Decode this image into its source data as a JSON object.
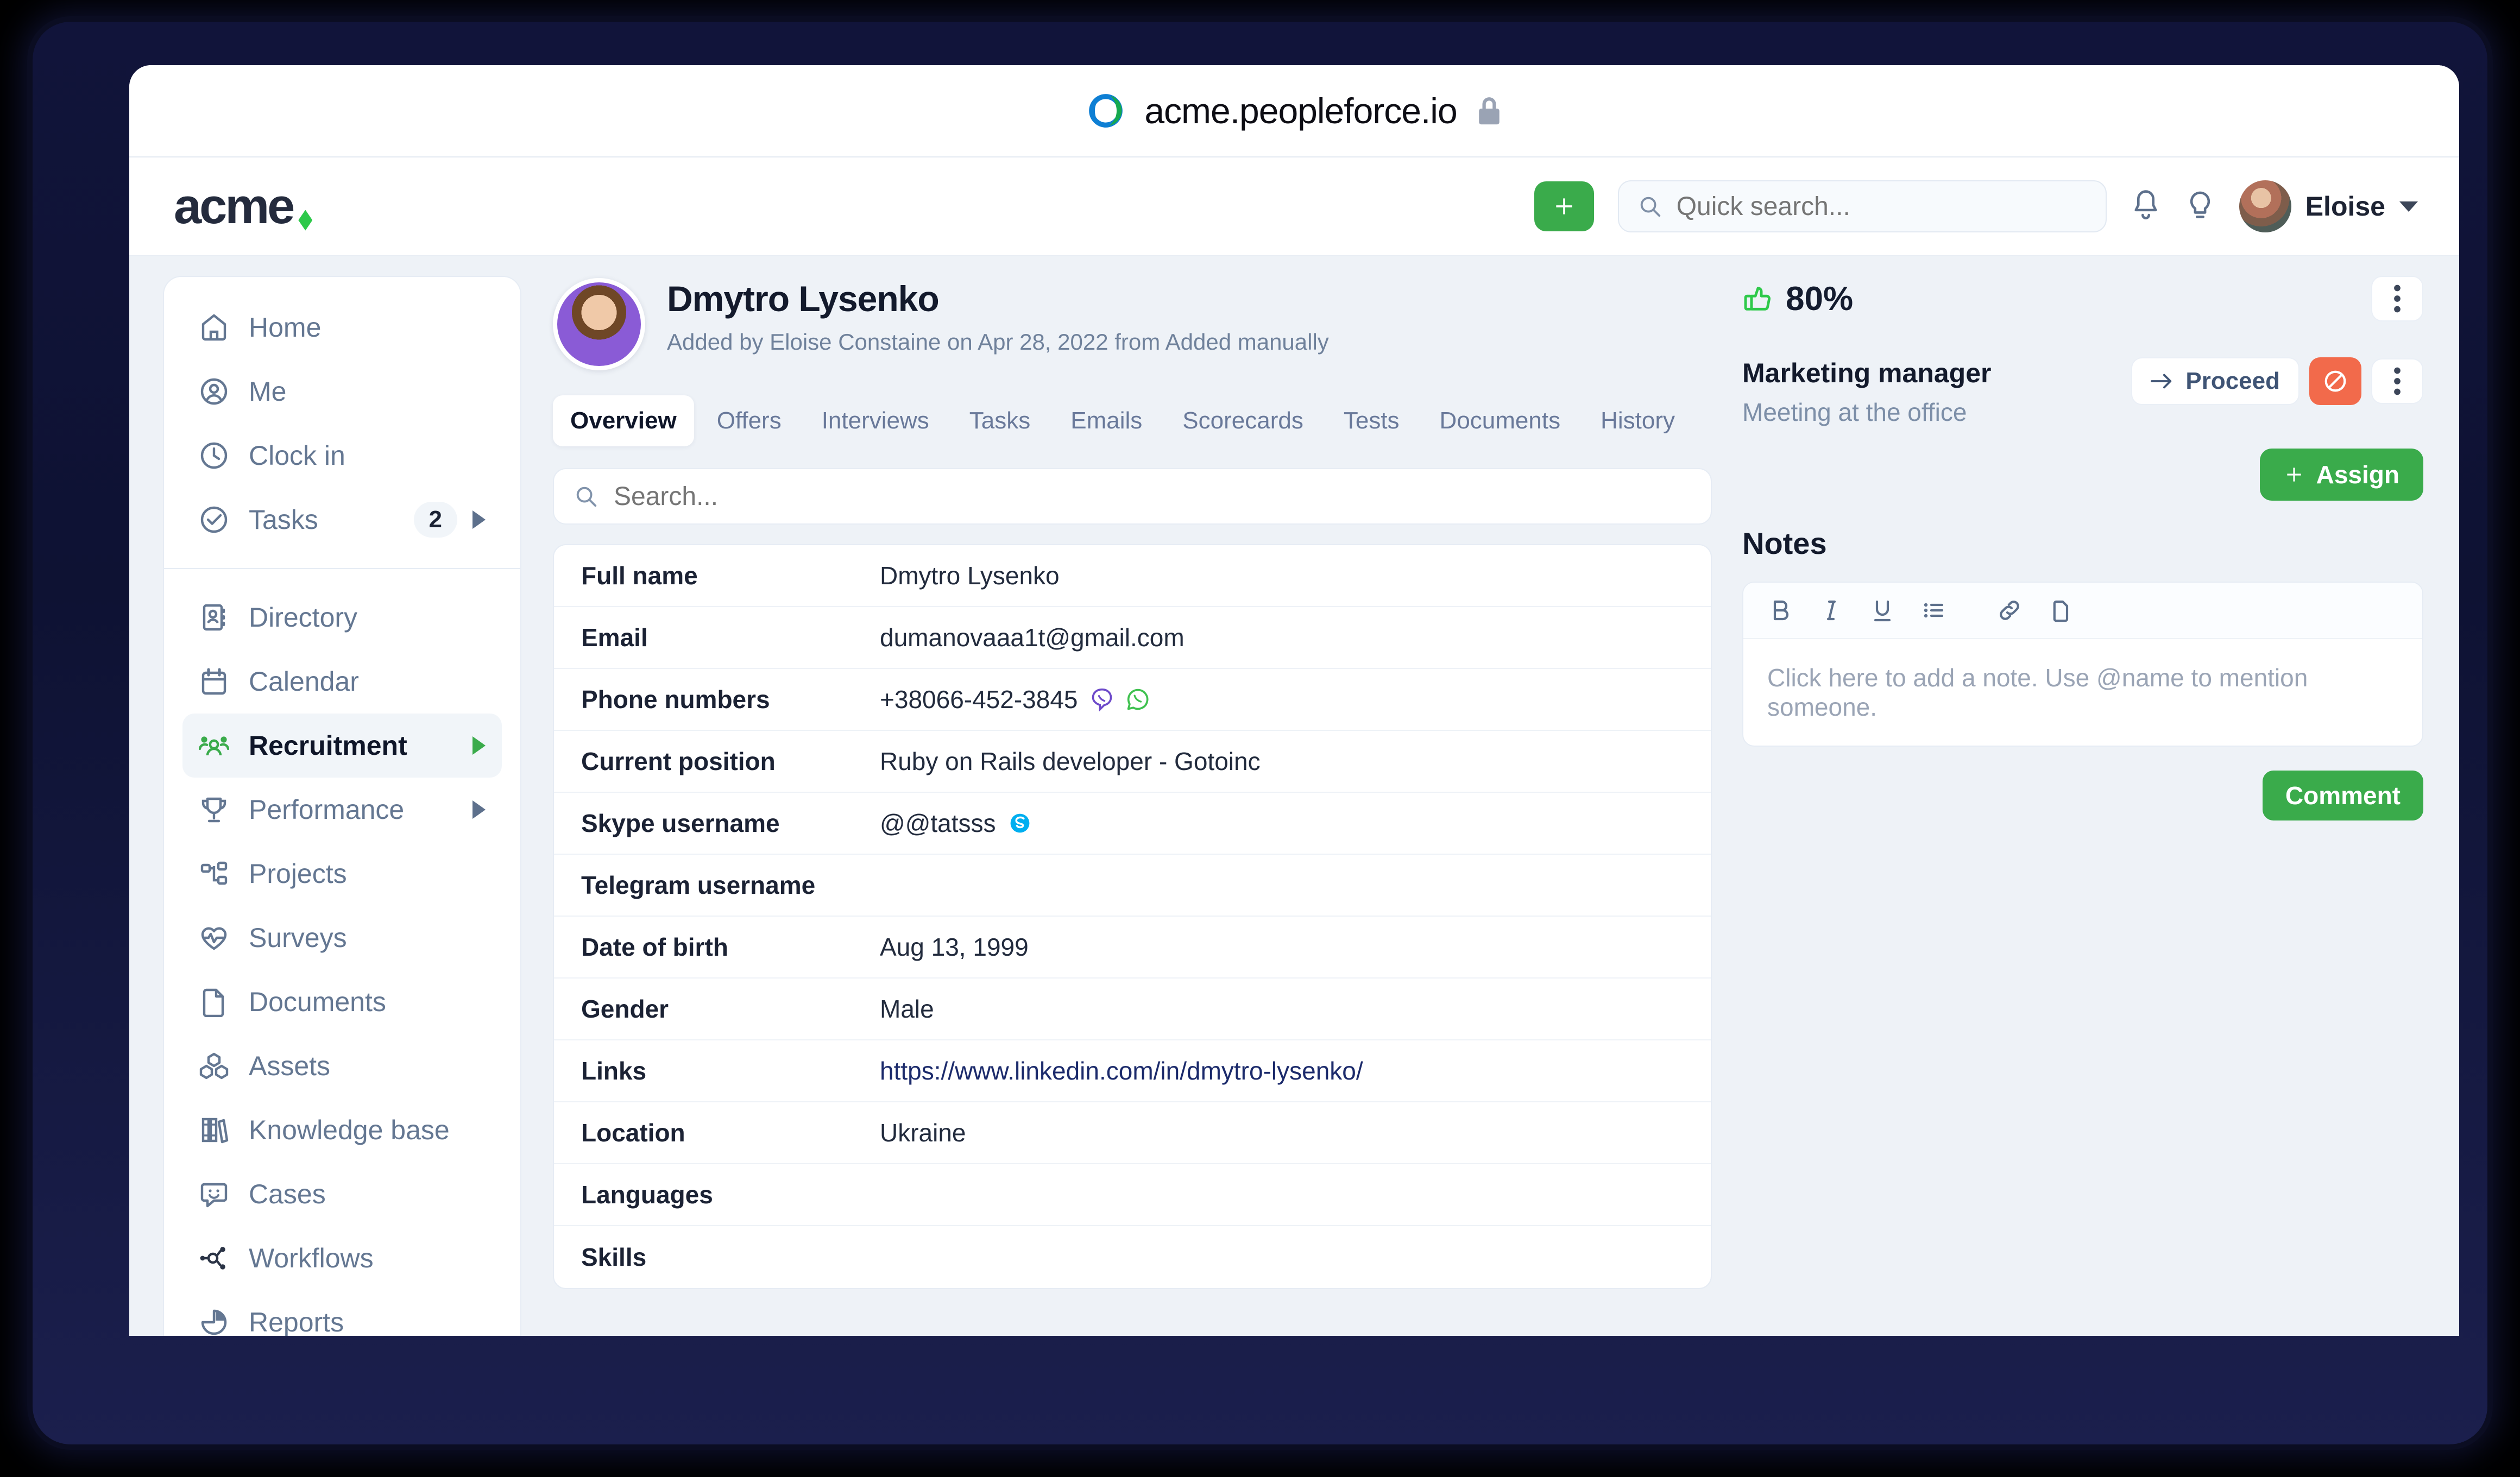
{
  "browser": {
    "url": "acme.peopleforce.io"
  },
  "topbar": {
    "logo_text": "acme",
    "add_button_label": "+",
    "quick_search_placeholder": "Quick search...",
    "user_name": "Eloise"
  },
  "sidebar": {
    "group1": [
      {
        "label": "Home",
        "icon": "home-icon"
      },
      {
        "label": "Me",
        "icon": "user-circle-icon"
      },
      {
        "label": "Clock in",
        "icon": "clock-icon"
      },
      {
        "label": "Tasks",
        "icon": "check-circle-icon",
        "badge": "2",
        "has_arrow": true
      }
    ],
    "group2": [
      {
        "label": "Directory",
        "icon": "contact-book-icon"
      },
      {
        "label": "Calendar",
        "icon": "calendar-icon"
      },
      {
        "label": "Recruitment",
        "icon": "people-group-icon",
        "active": true,
        "has_arrow": true
      },
      {
        "label": "Performance",
        "icon": "trophy-icon",
        "has_arrow": true
      },
      {
        "label": "Projects",
        "icon": "sitemap-icon"
      },
      {
        "label": "Surveys",
        "icon": "heart-pulse-icon"
      },
      {
        "label": "Documents",
        "icon": "document-icon"
      },
      {
        "label": "Assets",
        "icon": "boxes-icon"
      },
      {
        "label": "Knowledge base",
        "icon": "books-icon"
      },
      {
        "label": "Cases",
        "icon": "chat-smile-icon"
      },
      {
        "label": "Workflows",
        "icon": "workflow-nodes-icon"
      },
      {
        "label": "Reports",
        "icon": "pie-chart-icon"
      }
    ]
  },
  "candidate": {
    "name": "Dmytro Lysenko",
    "meta": "Added by Eloise Constaine on Apr 28, 2022 from Added manually",
    "tabs": [
      {
        "label": "Overview",
        "active": true
      },
      {
        "label": "Offers"
      },
      {
        "label": "Interviews"
      },
      {
        "label": "Tasks"
      },
      {
        "label": "Emails"
      },
      {
        "label": "Scorecards"
      },
      {
        "label": "Tests"
      },
      {
        "label": "Documents"
      },
      {
        "label": "History"
      }
    ],
    "search_placeholder": "Search...",
    "details": [
      {
        "label": "Full name",
        "value": "Dmytro Lysenko"
      },
      {
        "label": "Email",
        "value": "dumanovaaa1t@gmail.com"
      },
      {
        "label": "Phone numbers",
        "value": "+38066-452-3845",
        "icons": [
          "viber-icon",
          "whatsapp-icon"
        ]
      },
      {
        "label": "Current position",
        "value": "Ruby on Rails developer - Gotoinc"
      },
      {
        "label": "Skype username",
        "value": "@@tatsss",
        "icons": [
          "skype-icon"
        ]
      },
      {
        "label": "Telegram username",
        "value": ""
      },
      {
        "label": "Date of birth",
        "value": "Aug 13, 1999"
      },
      {
        "label": "Gender",
        "value": "Male"
      },
      {
        "label": "Links",
        "value": "https://www.linkedin.com/in/dmytro-lysenko/",
        "is_link": true
      },
      {
        "label": "Location",
        "value": "Ukraine"
      },
      {
        "label": "Languages",
        "value": ""
      },
      {
        "label": "Skills",
        "value": ""
      }
    ]
  },
  "rating": {
    "value": "80%",
    "icon": "thumbs-up-icon"
  },
  "job": {
    "title": "Marketing manager",
    "stage": "Meeting at the office",
    "proceed_label": "Proceed",
    "assign_label": "Assign"
  },
  "notes": {
    "title": "Notes",
    "toolbar": [
      "bold-icon",
      "italic-icon",
      "underline-icon",
      "bullet-list-icon",
      "link-icon",
      "attachment-icon"
    ],
    "placeholder": "Click here to add a note. Use @name to mention someone.",
    "comment_label": "Comment"
  },
  "colors": {
    "brand_green": "#3aab4b",
    "reject_orange": "#f26a4b",
    "app_bg": "#eef2f7",
    "text_dark": "#131a2c",
    "text_muted": "#6f819b"
  }
}
